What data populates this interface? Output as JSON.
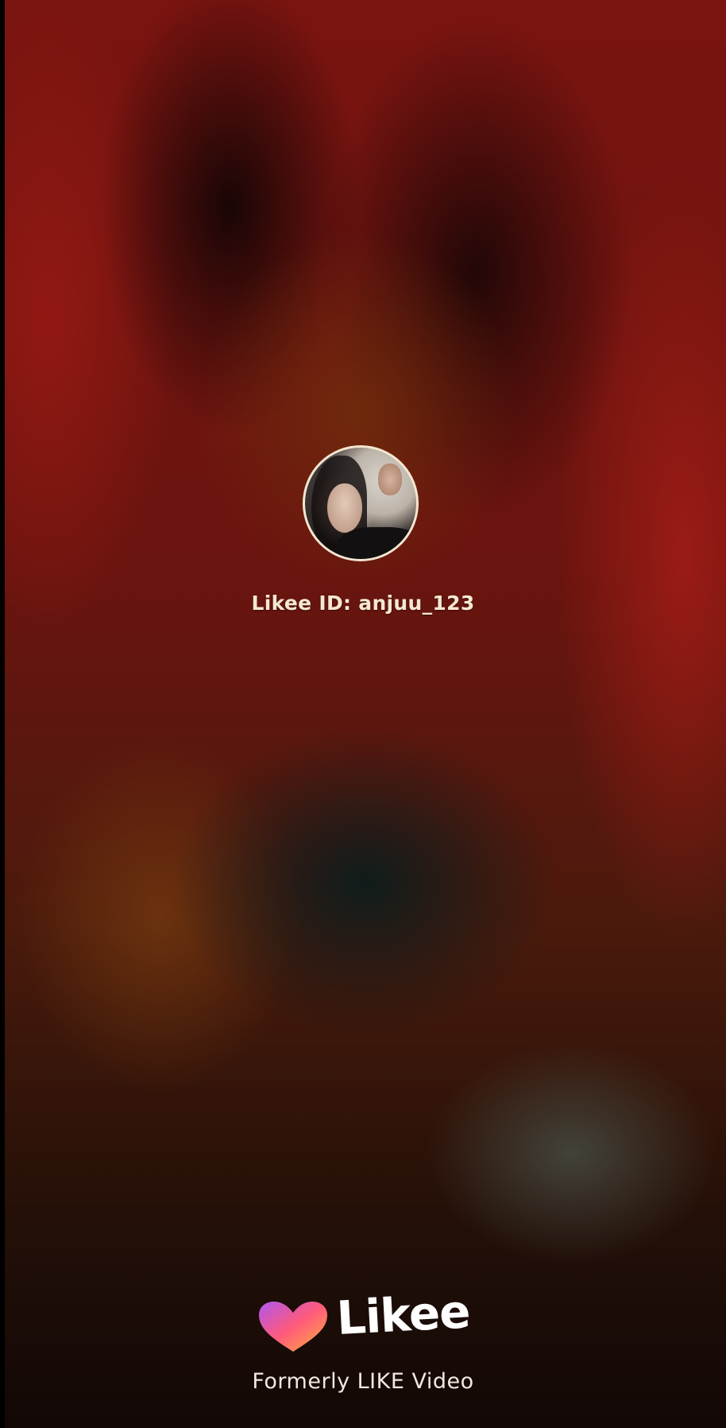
{
  "profile": {
    "likee_id": "Likee ID: anjuu_123"
  },
  "branding": {
    "logo_text": "Likee",
    "tagline": "Formerly LIKE Video",
    "heart_colors": [
      "#b057f0",
      "#ff5a7a",
      "#ffb23c"
    ]
  },
  "icons": {
    "logo_heart": "heart-logo-icon"
  }
}
